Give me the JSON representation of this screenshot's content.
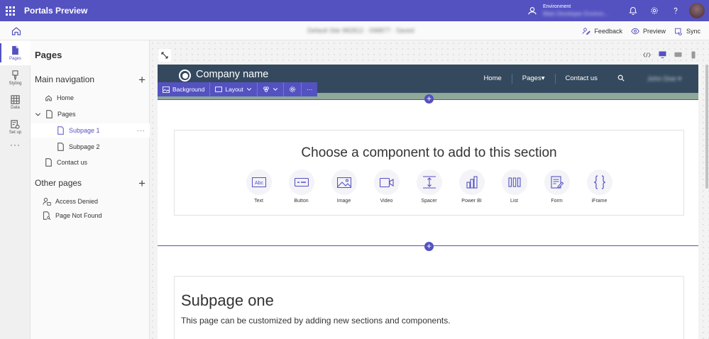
{
  "topbar": {
    "app_title": "Portals Preview",
    "environment_label": "Environment",
    "environment_value": "Main Developer Environ...",
    "icons": [
      "waffle-icon",
      "environment-icon",
      "bell-icon",
      "gear-icon",
      "help-icon",
      "avatar"
    ]
  },
  "command_bar": {
    "site_status": "Default Site 982812 · 098877 · Saved",
    "feedback_label": "Feedback",
    "preview_label": "Preview",
    "sync_label": "Sync"
  },
  "rail": {
    "items": [
      {
        "label": "Pages",
        "icon": "page-icon",
        "active": true
      },
      {
        "label": "Styling",
        "icon": "brush-icon",
        "active": false
      },
      {
        "label": "Data",
        "icon": "table-icon",
        "active": false
      },
      {
        "label": "Set up",
        "icon": "setup-icon",
        "active": false
      }
    ],
    "more_label": "···"
  },
  "panel": {
    "title": "Pages",
    "main_nav_label": "Main navigation",
    "other_pages_label": "Other pages",
    "main_nav_items": [
      {
        "label": "Home",
        "icon": "home-icon"
      },
      {
        "label": "Pages",
        "icon": "page-icon"
      },
      {
        "label": "Subpage 1",
        "icon": "page-icon"
      },
      {
        "label": "Subpage 2",
        "icon": "page-icon"
      },
      {
        "label": "Contact us",
        "icon": "page-icon"
      }
    ],
    "other_items": [
      {
        "label": "Access Denied",
        "icon": "person-lock-icon"
      },
      {
        "label": "Page Not Found",
        "icon": "page-search-icon"
      }
    ],
    "more_dots": "···"
  },
  "site": {
    "company_name": "Company name",
    "nav": [
      "Home",
      "Pages▾",
      "Contact us"
    ],
    "user_name": "John Doe ▾",
    "section_toolbar": {
      "background_label": "Background",
      "layout_label": "Layout",
      "more_label": "···"
    },
    "chooser_title": "Choose a component to add to this section",
    "components": [
      {
        "label": "Text",
        "icon": "text-box-icon"
      },
      {
        "label": "Button",
        "icon": "button-icon"
      },
      {
        "label": "Image",
        "icon": "image-icon"
      },
      {
        "label": "Video",
        "icon": "video-icon"
      },
      {
        "label": "Spacer",
        "icon": "spacer-icon"
      },
      {
        "label": "Power BI",
        "icon": "powerbi-icon"
      },
      {
        "label": "List",
        "icon": "list-icon"
      },
      {
        "label": "Form",
        "icon": "form-icon"
      },
      {
        "label": "iFrame",
        "icon": "braces-icon"
      }
    ],
    "subpage_title": "Subpage one",
    "subpage_desc": "This page can be customized by adding new sections and components.",
    "add_symbol": "+"
  },
  "colors": {
    "accent": "#5452c1",
    "site_header": "#34495e",
    "strip": "#8fa89a"
  }
}
